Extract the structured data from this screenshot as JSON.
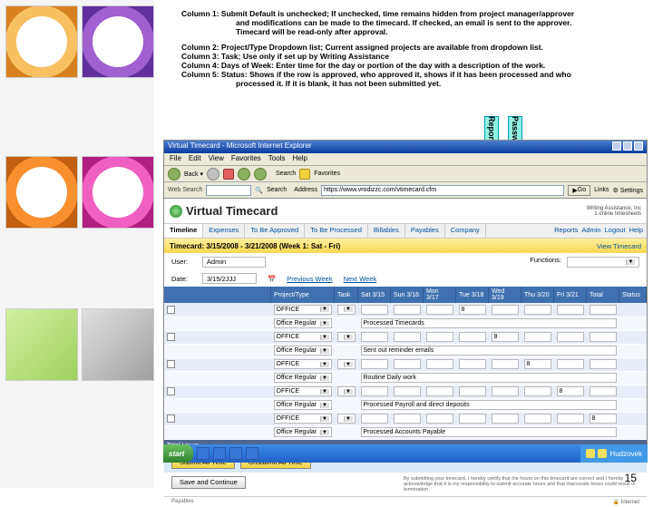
{
  "explain": {
    "col1_a": "Column 1: Submit  Default is unchecked; If unchecked, time remains hidden from project manager/approver",
    "col1_b": "and modifications can be made to the timecard. If checked, an email is sent to the approver.",
    "col1_c": "Timecard will be read-only after approval.",
    "col2": "Column 2: Project/Type  Dropdown list; Current assigned projects are available from dropdown list.",
    "col3": "Column 3: Task; Use only if set up by Writing Assistance",
    "col4": "Column 4: Days of Week: Enter time for the day or portion of the day with a description of the work.",
    "col5_a": "Column 5: Status: Shows if the row is approved, who approved it, shows if it has been processed and who",
    "col5_b": "processed it. If it is blank, it has not been submitted yet."
  },
  "arrows": {
    "a1": "Reports",
    "a2": "Password"
  },
  "browser": {
    "title": "Virtual Timecard - Microsoft Internet Explorer",
    "menus": [
      "File",
      "Edit",
      "View",
      "Favorites",
      "Tools",
      "Help"
    ],
    "addr_label": "Address",
    "url": "https://www.vrodizzc.com/vtimecard.cfm",
    "go": "Go",
    "links": "Links",
    "search": "Search",
    "favorites": "Favorites",
    "websearch": "Web Search",
    "settings": "Settings"
  },
  "app": {
    "title": "Virtual Timecard",
    "brand1": "Writing Assistance, Inc",
    "brand2": "1 online timesheets",
    "tabs": [
      "Timeline",
      "Expenses",
      "To Be Approved",
      "To Be Processed",
      "Billables",
      "Payables",
      "Company"
    ],
    "rlinks": [
      "Reports",
      "Admin",
      "Logout",
      "Help"
    ],
    "tcbar_label": "Timecard:",
    "tcbar_range": "3/15/2008 - 3/21/2008 (Week 1:  Sat - Fri)",
    "view_link": "View Timecard",
    "user_label": "User:",
    "user_value": "Admin",
    "func_label": "Functions:",
    "date_label": "Date:",
    "date_value": "3/15/2JJJ",
    "cal": "📅",
    "prev": "Previous Week",
    "next": "Next Week",
    "headers": [
      "",
      "Project/Type",
      "Task",
      "Sat 3/15",
      "Sun 3/16",
      "Mon 3/17",
      "Tue 3/18",
      "Wed 3/19",
      "Thu 3/20",
      "Fri 3/21",
      "Total",
      "Status"
    ],
    "rows": [
      {
        "proj": "OFFICE",
        "task": "",
        "d": [
          "",
          "",
          "",
          "8",
          "",
          "",
          "",
          ""
        ],
        "desc": ""
      },
      {
        "proj": "Office Regular",
        "task": "",
        "d": [
          "",
          "",
          "",
          "",
          "",
          "",
          "",
          ""
        ],
        "desc": "Processed Timecards"
      },
      {
        "proj": "OFFICE",
        "task": "",
        "d": [
          "",
          "",
          "",
          "",
          "8",
          "",
          "",
          ""
        ],
        "desc": ""
      },
      {
        "proj": "Office Regular",
        "task": "",
        "d": [
          "",
          "",
          "",
          "",
          "",
          "",
          "",
          ""
        ],
        "desc": "Sent out reminder emails"
      },
      {
        "proj": "OFFICE",
        "task": "",
        "d": [
          "",
          "",
          "",
          "",
          "",
          "8",
          "",
          ""
        ],
        "desc": ""
      },
      {
        "proj": "Office Regular",
        "task": "",
        "d": [
          "",
          "",
          "",
          "",
          "",
          "",
          "",
          ""
        ],
        "desc": "Routine Daily work"
      },
      {
        "proj": "OFFICE",
        "task": "",
        "d": [
          "",
          "",
          "",
          "",
          "",
          "",
          "8",
          ""
        ],
        "desc": ""
      },
      {
        "proj": "Office Regular",
        "task": "",
        "d": [
          "",
          "",
          "",
          "",
          "",
          "",
          "",
          ""
        ],
        "desc": "Processed Payroll and direct deposits"
      },
      {
        "proj": "OFFICE",
        "task": "",
        "d": [
          "",
          "",
          "",
          "",
          "",
          "",
          "",
          "8"
        ],
        "desc": ""
      },
      {
        "proj": "Office Regular",
        "task": "",
        "d": [
          "",
          "",
          "",
          "",
          "",
          "",
          "",
          ""
        ],
        "desc": "Processed Accounts Payable"
      }
    ],
    "totals_label": "Total Hours",
    "btn1": "Submit All Time",
    "btn2": "Unsubmit All Time",
    "btn3": "Save and Continue",
    "foot_note": "By submitting your timecard, I hereby certify that the hours on this timecard are correct and I hereby acknowledge that it is my responsibility to submit accurate hours and that inaccurate hours could result in termination.",
    "foot_pay": "Payables"
  },
  "taskbar": {
    "start": "start",
    "items": [
      "",
      "",
      "",
      "",
      ""
    ],
    "tray_text": "Hudzovek"
  },
  "page_num": "15"
}
